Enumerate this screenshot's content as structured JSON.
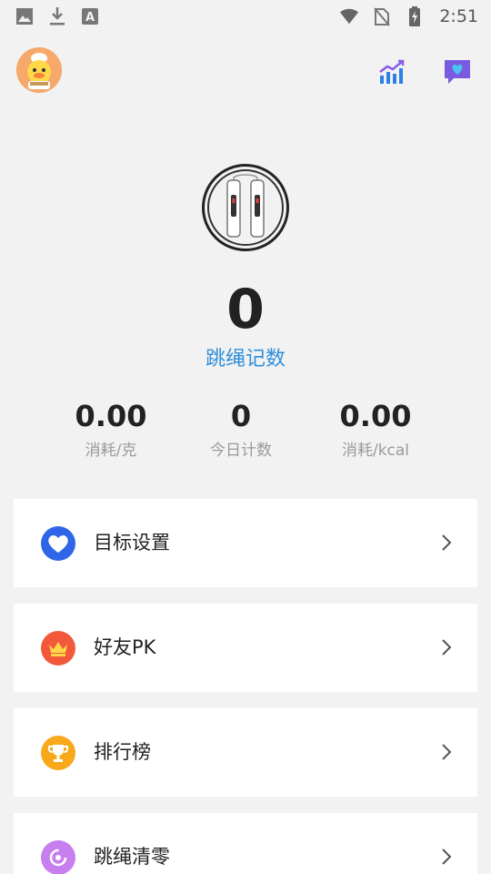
{
  "status_bar": {
    "time": "2:51",
    "left_icons": [
      "image-icon",
      "download-icon",
      "font-a-icon"
    ],
    "right_icons": [
      "wifi-icon",
      "no-sim-icon",
      "battery-charging-icon"
    ]
  },
  "header": {
    "avatar_icon": "duck-avatar-icon",
    "stats_icon": "trend-chart-icon",
    "message_icon": "heart-message-icon"
  },
  "device": {
    "icon": "jump-rope-icon"
  },
  "counter": {
    "value": "0",
    "label": "跳绳记数"
  },
  "stats": [
    {
      "value": "0.00",
      "label": "消耗/克"
    },
    {
      "value": "0",
      "label": "今日计数"
    },
    {
      "value": "0.00",
      "label": "消耗/kcal"
    }
  ],
  "menu": [
    {
      "label": "目标设置",
      "icon": "heart-icon",
      "color": "#2f66e8"
    },
    {
      "label": "好友PK",
      "icon": "crown-icon",
      "color": "#f2583a"
    },
    {
      "label": "排行榜",
      "icon": "trophy-icon",
      "color": "#f7a81b"
    },
    {
      "label": "跳绳清零",
      "icon": "reset-icon",
      "color": "#c77ff0"
    }
  ],
  "colors": {
    "accent": "#2f8fdc",
    "background": "#f2f2f2"
  }
}
